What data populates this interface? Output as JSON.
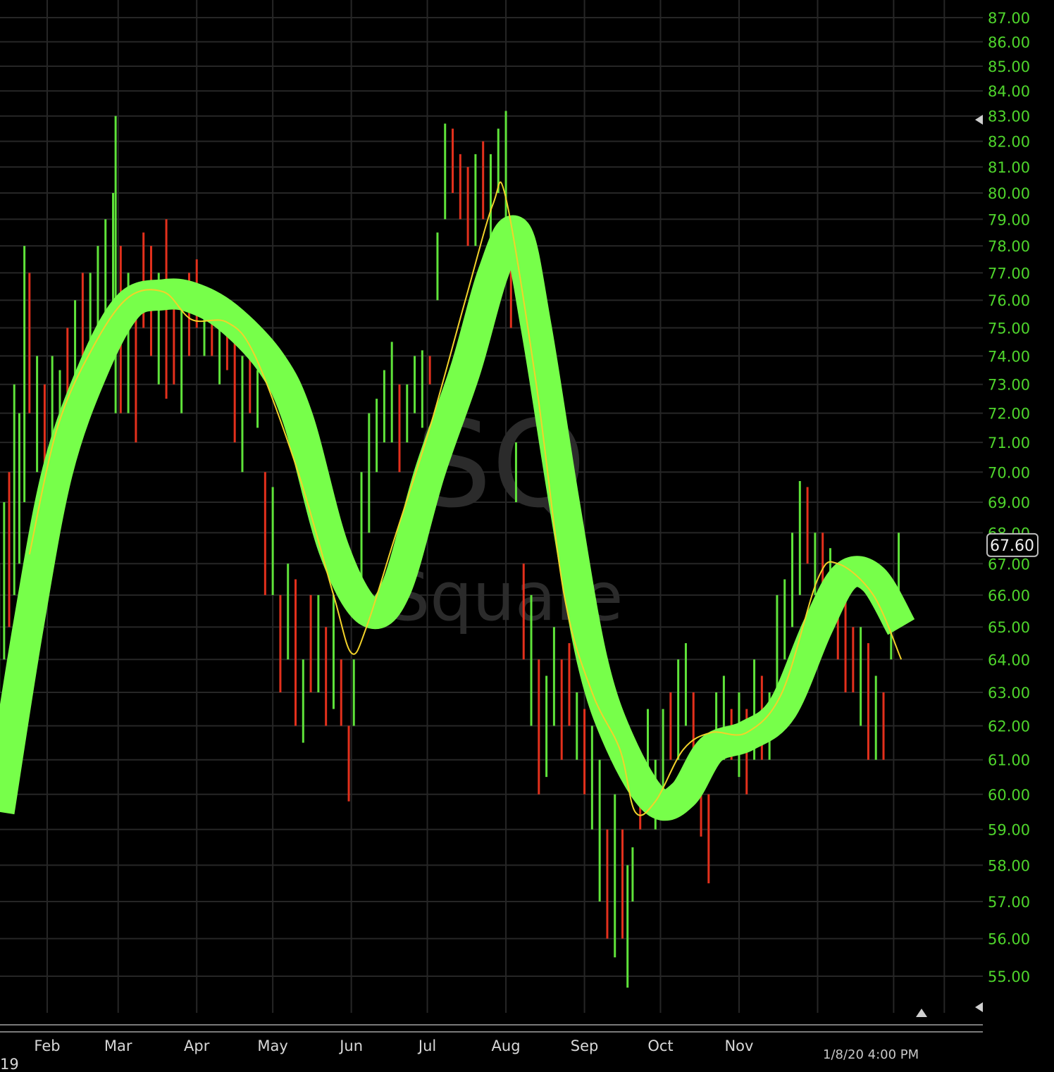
{
  "chart_data": {
    "type": "line",
    "ticker_watermark": "SQ",
    "company_watermark": "Square",
    "title": "",
    "xlabel": "",
    "ylabel": "",
    "y_scale": "log",
    "ylim": [
      54.5,
      87.3
    ],
    "y_ticks": [
      "87.00",
      "86.00",
      "85.00",
      "84.00",
      "83.00",
      "82.00",
      "81.00",
      "80.00",
      "79.00",
      "78.00",
      "77.00",
      "76.00",
      "75.00",
      "74.00",
      "73.00",
      "72.00",
      "71.00",
      "70.00",
      "69.00",
      "68.00",
      "67.00",
      "66.00",
      "65.00",
      "64.00",
      "63.00",
      "62.00",
      "61.00",
      "60.00",
      "59.00",
      "58.00",
      "57.00",
      "56.00",
      "55.00"
    ],
    "x_unit": "day of 2019",
    "x_ticks": [
      {
        "label": "Feb",
        "day": 31
      },
      {
        "label": "Mar",
        "day": 59
      },
      {
        "label": "Apr",
        "day": 90
      },
      {
        "label": "May",
        "day": 120
      },
      {
        "label": "Jun",
        "day": 151
      },
      {
        "label": "Jul",
        "day": 181
      },
      {
        "label": "Aug",
        "day": 212
      },
      {
        "label": "Sep",
        "day": 243
      },
      {
        "label": "Oct",
        "day": 273
      },
      {
        "label": "Nov",
        "day": 304
      }
    ],
    "extra_gridline_days": [
      335,
      365,
      385
    ],
    "year_label": "19",
    "timestamp": "1/8/20 4:00 PM",
    "last_price": "67.60",
    "last_price_value": 67.6,
    "colors": {
      "up": "#5fe33a",
      "down": "#e3301c",
      "thick_ma": "#77ff4a",
      "thin_ma": "#f2d22a",
      "axis": "#4fd52c",
      "grid": "#262626"
    },
    "bars": {
      "day": [
        12,
        14,
        16,
        18,
        20,
        22,
        24,
        27,
        30,
        33,
        36,
        39,
        42,
        45,
        48,
        51,
        54,
        57,
        58,
        60,
        63,
        66,
        69,
        72,
        75,
        78,
        81,
        84,
        87,
        90,
        93,
        96,
        99,
        102,
        105,
        108,
        111,
        114,
        117,
        120,
        123,
        126,
        129,
        132,
        135,
        138,
        141,
        144,
        147,
        150,
        152,
        155,
        158,
        161,
        164,
        167,
        170,
        173,
        176,
        179,
        182,
        185,
        188,
        191,
        194,
        197,
        200,
        203,
        206,
        209,
        212,
        214,
        216,
        219,
        222,
        225,
        228,
        231,
        234,
        237,
        240,
        243,
        246,
        249,
        252,
        255,
        258,
        260,
        262,
        265,
        268,
        271,
        274,
        277,
        280,
        283,
        286,
        289,
        292,
        295,
        298,
        301,
        304,
        307,
        310,
        313,
        316,
        319,
        322,
        325,
        328,
        331,
        334,
        337,
        340,
        343,
        346,
        349,
        352,
        355,
        358,
        361,
        364,
        367
      ],
      "low": [
        63,
        64,
        65,
        66,
        67,
        69,
        72,
        70,
        69,
        70,
        71,
        72,
        73,
        74,
        74,
        75,
        74,
        74,
        72,
        72,
        72,
        71,
        75,
        74,
        73,
        72.5,
        73,
        72,
        74,
        75,
        74,
        74,
        73,
        73.5,
        71,
        70,
        72,
        71.5,
        66,
        66,
        63,
        64,
        62,
        61.5,
        63,
        63,
        62,
        62.5,
        62,
        59.8,
        62,
        66,
        68,
        70,
        71,
        71,
        70,
        71,
        72,
        71.5,
        73,
        76,
        79,
        80,
        79,
        78,
        78,
        79,
        78,
        80,
        79,
        75,
        69,
        64,
        62,
        60,
        60.5,
        62,
        61,
        62,
        61,
        60,
        59,
        57,
        56,
        55.5,
        56,
        54.7,
        57,
        59,
        60,
        59,
        60,
        61,
        61,
        62,
        60,
        58.8,
        57.5,
        61,
        61,
        61,
        60.5,
        60,
        61,
        61,
        61,
        63,
        64,
        65,
        66,
        67,
        66,
        65,
        65,
        64,
        63,
        63,
        62,
        61,
        61,
        61,
        64,
        65
      ],
      "high": [
        67,
        69,
        70,
        73,
        72,
        78,
        77,
        74,
        73,
        74,
        73.5,
        75,
        76,
        77,
        77,
        78,
        79,
        80,
        83,
        78,
        77,
        75.5,
        78.5,
        78,
        77,
        79,
        76.5,
        76,
        77,
        77.5,
        76.5,
        76,
        76,
        75.5,
        75,
        74,
        74,
        73.5,
        70,
        69.5,
        66,
        67,
        66.5,
        64,
        66,
        66,
        65,
        66,
        64,
        62,
        64,
        70,
        72,
        72.5,
        73.5,
        74.5,
        73,
        73,
        74,
        74.2,
        74,
        78.5,
        82.7,
        82.5,
        81.5,
        81,
        81.5,
        82,
        81.5,
        82.5,
        83.2,
        79,
        71,
        67,
        66,
        64,
        63.5,
        65,
        64,
        64.5,
        63,
        62.5,
        62,
        61,
        59,
        60,
        59,
        58,
        58.5,
        61,
        62.5,
        61,
        62.5,
        63,
        64,
        64.5,
        63,
        61.5,
        60,
        63,
        63.5,
        62.5,
        63,
        62.5,
        64,
        63.5,
        63,
        66,
        66.5,
        68,
        69.7,
        69.5,
        68,
        68,
        67.5,
        67,
        66.5,
        65,
        65,
        64.5,
        63.5,
        63,
        66,
        68
      ],
      "up": [
        1,
        1,
        0,
        1,
        1,
        1,
        0,
        1,
        0,
        1,
        1,
        0,
        1,
        0,
        1,
        1,
        1,
        1,
        1,
        0,
        1,
        0,
        0,
        0,
        1,
        0,
        0,
        1,
        0,
        0,
        1,
        0,
        1,
        0,
        0,
        1,
        0,
        1,
        0,
        1,
        0,
        1,
        0,
        1,
        0,
        1,
        0,
        1,
        0,
        0,
        1,
        1,
        1,
        1,
        1,
        1,
        0,
        1,
        1,
        1,
        0,
        1,
        1,
        0,
        0,
        0,
        1,
        0,
        1,
        1,
        1,
        0,
        1,
        0,
        1,
        0,
        1,
        1,
        0,
        0,
        1,
        0,
        1,
        1,
        0,
        1,
        0,
        1,
        1,
        0,
        1,
        1,
        1,
        0,
        1,
        1,
        0,
        0,
        0,
        1,
        1,
        0,
        1,
        0,
        1,
        0,
        1,
        1,
        1,
        1,
        1,
        0,
        1,
        0,
        1,
        0,
        0,
        0,
        1,
        0,
        1,
        0,
        1,
        1
      ]
    },
    "series": [
      {
        "name": "long moving average (thick)",
        "points": [
          [
            12,
            59.5
          ],
          [
            23.5,
            65
          ],
          [
            35,
            70
          ],
          [
            49,
            73.5
          ],
          [
            63,
            75.8
          ],
          [
            77,
            76.2
          ],
          [
            88,
            76.1
          ],
          [
            102,
            75.4
          ],
          [
            119,
            73.8
          ],
          [
            130,
            71.8
          ],
          [
            144,
            67.5
          ],
          [
            157.5,
            65.5
          ],
          [
            168.6,
            66.2
          ],
          [
            182,
            70
          ],
          [
            196,
            73.5
          ],
          [
            207,
            77
          ],
          [
            216,
            78.5
          ],
          [
            224,
            75
          ],
          [
            235,
            69
          ],
          [
            246,
            64
          ],
          [
            257,
            61.5
          ],
          [
            271,
            59.8
          ],
          [
            282,
            60
          ],
          [
            293,
            61.3
          ],
          [
            307,
            61.7
          ],
          [
            321,
            62.5
          ],
          [
            335,
            65
          ],
          [
            346,
            66.6
          ],
          [
            357,
            66.5
          ],
          [
            368,
            65
          ]
        ]
      },
      {
        "name": "short moving average (thin)",
        "points": [
          [
            24,
            67.3
          ],
          [
            35,
            71.5
          ],
          [
            49,
            74.3
          ],
          [
            63,
            76.1
          ],
          [
            77,
            76.3
          ],
          [
            88,
            75.3
          ],
          [
            102,
            75.2
          ],
          [
            113,
            74
          ],
          [
            130,
            70
          ],
          [
            144,
            66
          ],
          [
            151,
            64.2
          ],
          [
            157,
            65
          ],
          [
            168,
            67.8
          ],
          [
            182,
            71.5
          ],
          [
            196,
            76
          ],
          [
            207,
            79.6
          ],
          [
            212,
            79.8
          ],
          [
            224,
            73
          ],
          [
            235,
            66
          ],
          [
            246,
            63
          ],
          [
            257,
            61.3
          ],
          [
            263,
            59.5
          ],
          [
            271,
            59.8
          ],
          [
            282,
            61.3
          ],
          [
            293,
            61.8
          ],
          [
            307,
            61.8
          ],
          [
            321,
            63
          ],
          [
            335,
            66.5
          ],
          [
            343,
            67
          ],
          [
            357,
            66
          ],
          [
            368,
            64
          ]
        ]
      }
    ]
  }
}
